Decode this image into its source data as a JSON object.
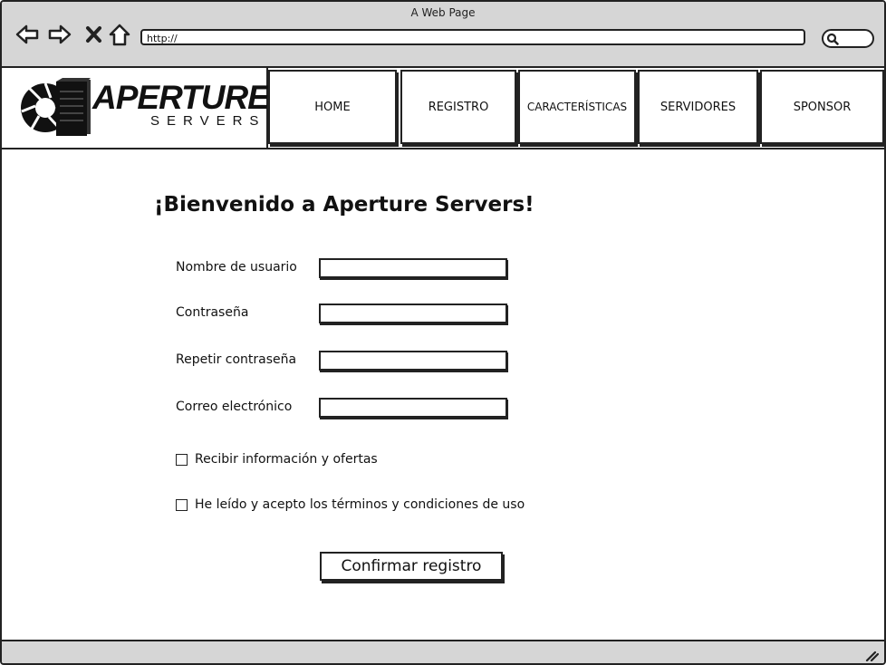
{
  "browser": {
    "window_title": "A Web Page",
    "url": "http://"
  },
  "logo": {
    "word": "APERTURE",
    "sub": "SERVERS"
  },
  "nav": {
    "items": [
      {
        "label": "HOME"
      },
      {
        "label": "REGISTRO"
      },
      {
        "label": "CARACTERÍSTICAS"
      },
      {
        "label": "SERVIDORES"
      },
      {
        "label": "SPONSOR"
      }
    ]
  },
  "form": {
    "title": "¡Bienvenido a Aperture Servers!",
    "fields": [
      {
        "label": "Nombre de usuario",
        "value": ""
      },
      {
        "label": "Contraseña",
        "value": ""
      },
      {
        "label": "Repetir contraseña",
        "value": ""
      },
      {
        "label": "Correo electrónico",
        "value": ""
      }
    ],
    "checkboxes": [
      {
        "label": "Recibir información y ofertas",
        "checked": false
      },
      {
        "label": "He leído y acepto los términos y condiciones de uso",
        "checked": false
      }
    ],
    "submit_label": "Confirmar registro"
  }
}
